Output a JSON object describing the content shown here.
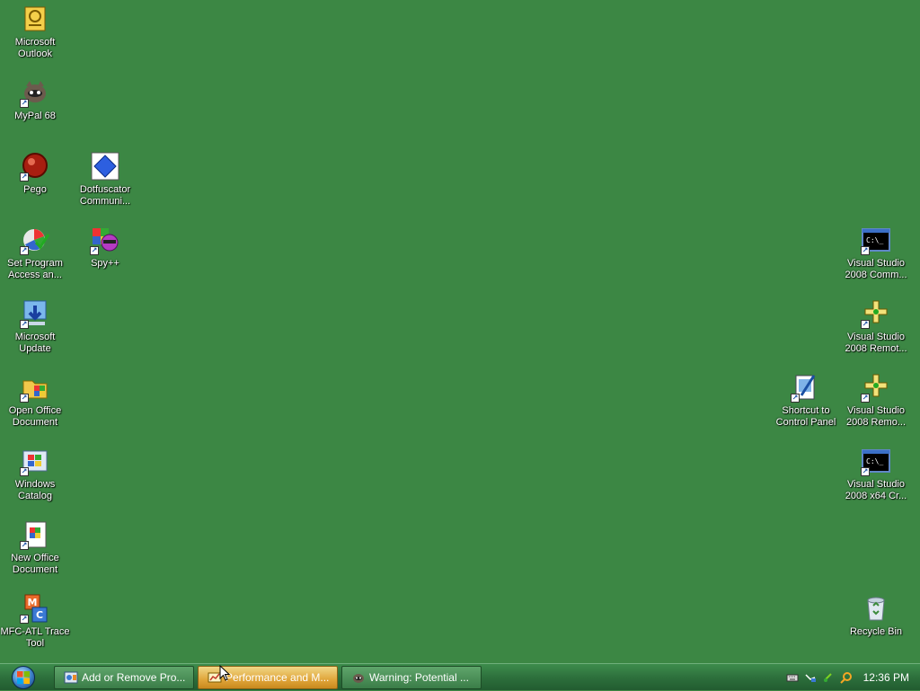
{
  "desktop": {
    "icons": [
      {
        "key": "outlook",
        "label": "Microsoft\nOutlook"
      },
      {
        "key": "mypal",
        "label": "MyPal 68"
      },
      {
        "key": "pego",
        "label": "Pego"
      },
      {
        "key": "dotfuscator",
        "label": "Dotfuscator\nCommuni..."
      },
      {
        "key": "setprog",
        "label": "Set Program\nAccess an..."
      },
      {
        "key": "spy",
        "label": "Spy++"
      },
      {
        "key": "msupdate",
        "label": "Microsoft\nUpdate"
      },
      {
        "key": "openoffice",
        "label": "Open Office\nDocument"
      },
      {
        "key": "catalog",
        "label": "Windows\nCatalog"
      },
      {
        "key": "newoffice",
        "label": "New Office\nDocument"
      },
      {
        "key": "mfcatl",
        "label": "MFC-ATL Trace\nTool"
      },
      {
        "key": "vs_comm",
        "label": "Visual Studio\n2008 Comm..."
      },
      {
        "key": "vs_remote1",
        "label": "Visual Studio\n2008 Remot..."
      },
      {
        "key": "controlpanel",
        "label": "Shortcut to\nControl Panel"
      },
      {
        "key": "vs_remote2",
        "label": "Visual Studio\n2008 Remo..."
      },
      {
        "key": "vs_x64",
        "label": "Visual Studio\n2008 x64 Cr..."
      },
      {
        "key": "recycle",
        "label": "Recycle Bin"
      }
    ]
  },
  "taskbar": {
    "tasks": [
      {
        "label": "Add or Remove Pro...",
        "active": false
      },
      {
        "label": "Performance and M...",
        "active": true
      },
      {
        "label": "Warning: Potential ...",
        "active": false
      }
    ],
    "clock": "12:36 PM"
  },
  "colors": {
    "desktop": "#3c8744",
    "taskbar": "#2c6e3b",
    "active_task": "#e0a53a"
  }
}
